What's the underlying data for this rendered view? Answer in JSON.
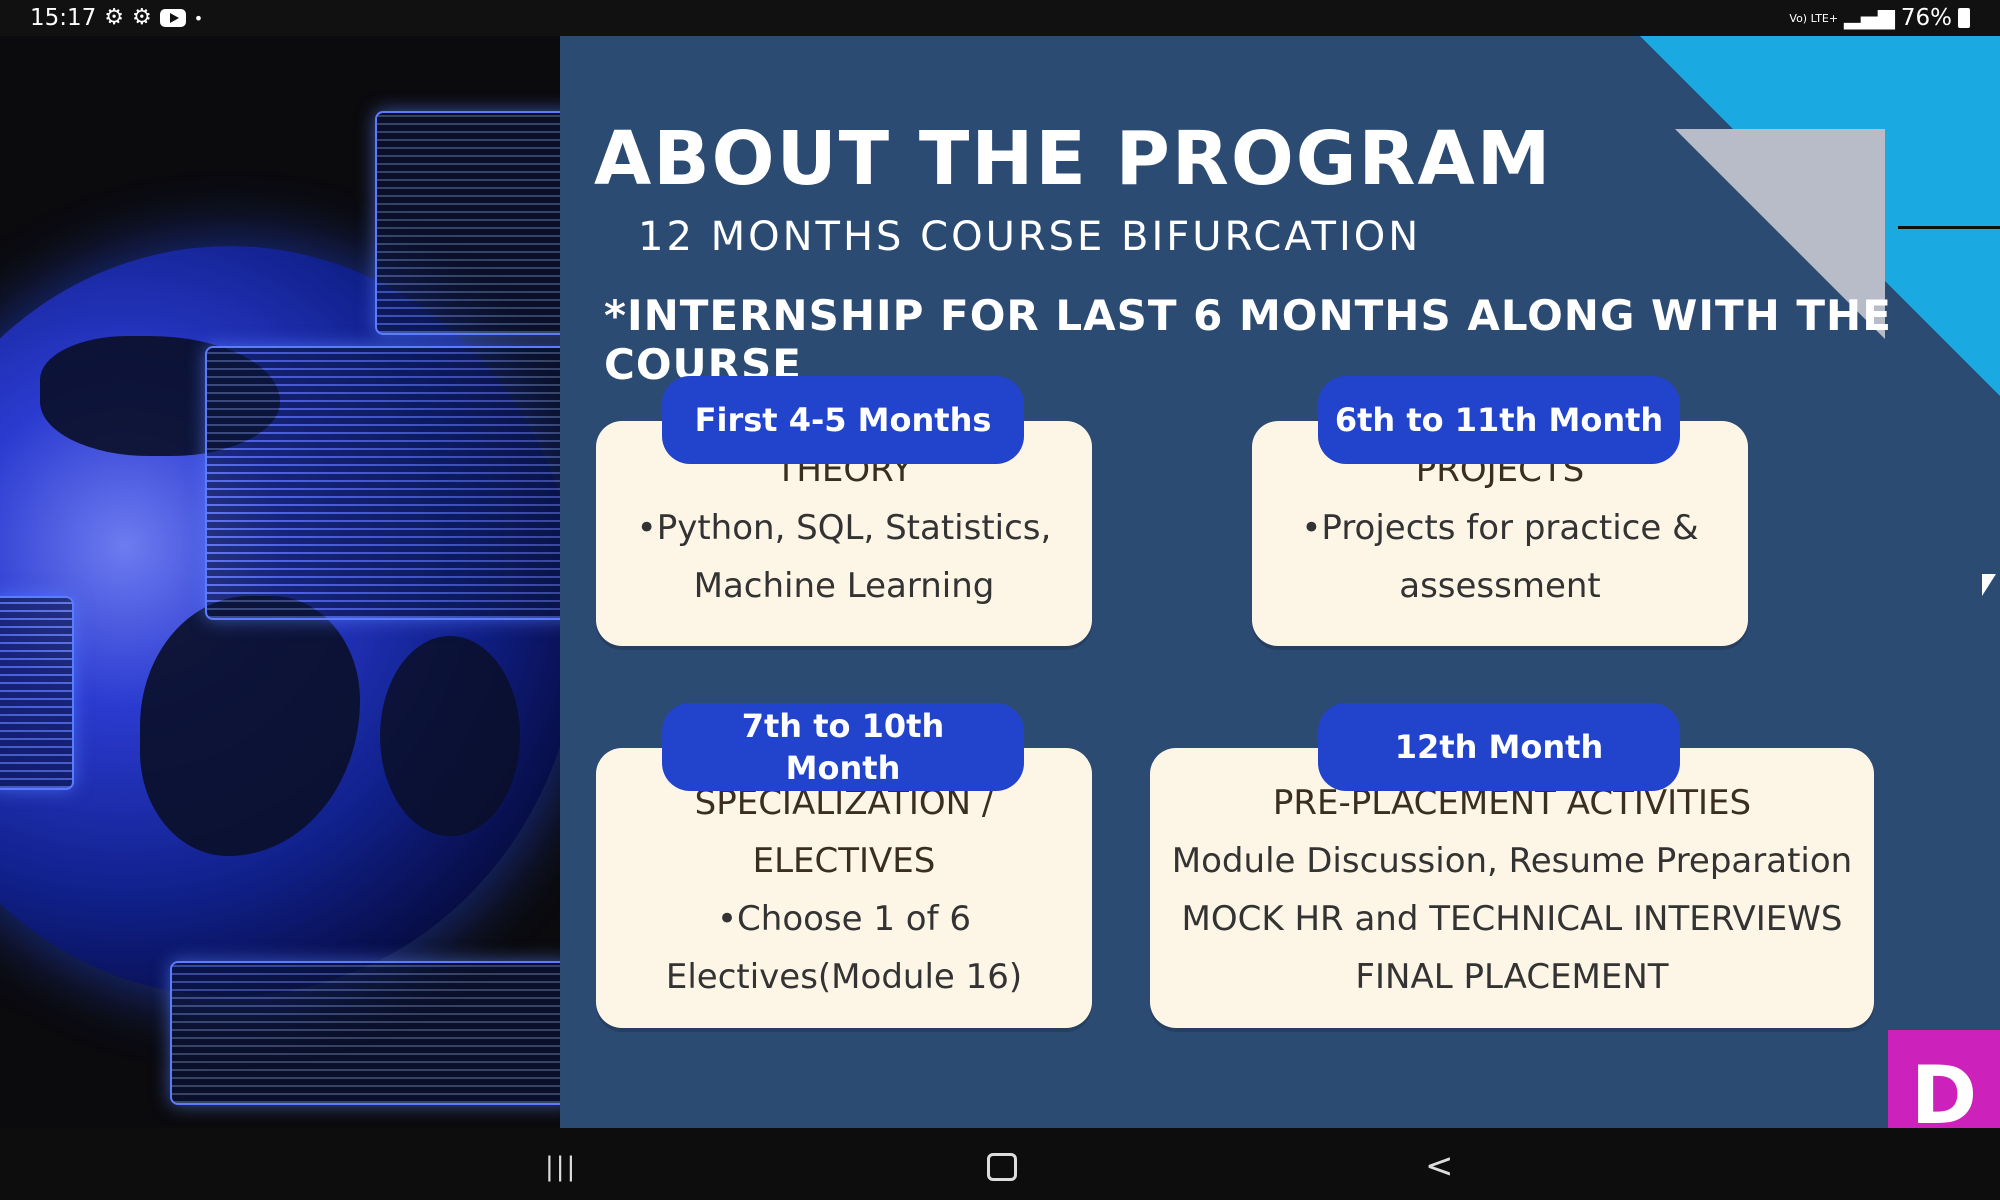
{
  "status_bar": {
    "time": "15:17",
    "net": "Vo) LTE+",
    "net_sub": "LTE",
    "battery": "76%",
    "icons": [
      "gear-icon",
      "gear-icon",
      "youtube-icon",
      "dot-icon",
      "signal-icon",
      "battery-icon"
    ]
  },
  "slide": {
    "title": "ABOUT THE PROGRAM",
    "subtitle": "12 MONTHS COURSE BIFURCATION",
    "note": "*INTERNSHIP FOR LAST 6 MONTHS ALONG WITH THE COURSE",
    "cards": [
      {
        "label": "First 4-5 Months",
        "heading": "THEORY",
        "lines": [
          "•Python, SQL, Statistics,",
          "Machine Learning"
        ]
      },
      {
        "label": "6th to 11th Month",
        "heading": "PROJECTS",
        "lines": [
          "•Projects for practice &",
          "assessment"
        ]
      },
      {
        "label": "7th to 10th Month",
        "heading_lines": [
          "SPECIALIZATION /",
          "ELECTIVES"
        ],
        "lines": [
          "•Choose 1 of 6",
          "Electives(Module 16)"
        ]
      },
      {
        "label": "12th Month",
        "heading": "PRE-PLACEMENT ACTIVITIES",
        "lines": [
          "Module Discussion, Resume Preparation",
          "MOCK HR and TECHNICAL INTERVIEWS",
          "FINAL PLACEMENT"
        ]
      }
    ],
    "brand_letter": "D"
  },
  "nav_bar": {
    "recent": "|||",
    "back": "<"
  },
  "colors": {
    "slide_bg": "#2c4b73",
    "label_bg": "#2244cc",
    "card_bg": "#fdf5e6",
    "accent_cyan": "#1ba9e2",
    "brand_magenta": "#cc22bb"
  }
}
